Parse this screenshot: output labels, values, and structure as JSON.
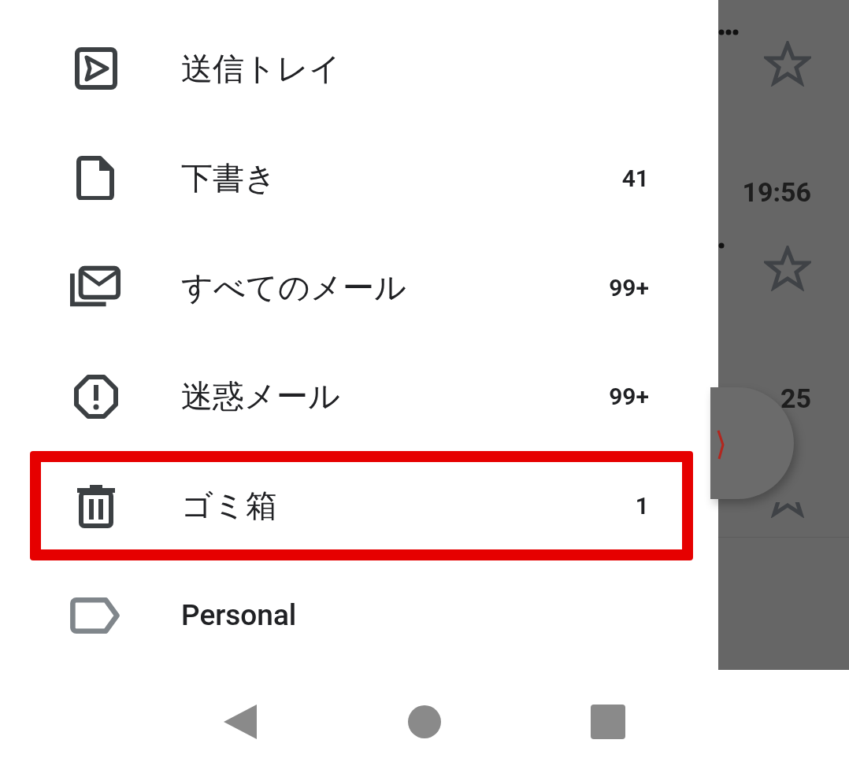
{
  "drawer": {
    "items": [
      {
        "kind": "sent",
        "label": "送信トレイ",
        "highlighted": false
      },
      {
        "kind": "draft",
        "label": "下書き",
        "count": "41",
        "highlighted": false
      },
      {
        "kind": "all",
        "label": "すべてのメール",
        "count": "99+",
        "highlighted": false
      },
      {
        "kind": "spam",
        "label": "迷惑メール",
        "count": "99+",
        "highlighted": false
      },
      {
        "kind": "trash",
        "label": "ゴミ箱",
        "count": "1",
        "highlighted": true
      },
      {
        "kind": "label",
        "label": "Personal",
        "highlighted": false
      }
    ]
  },
  "background_list": {
    "times": [
      "19:56",
      "25"
    ]
  }
}
